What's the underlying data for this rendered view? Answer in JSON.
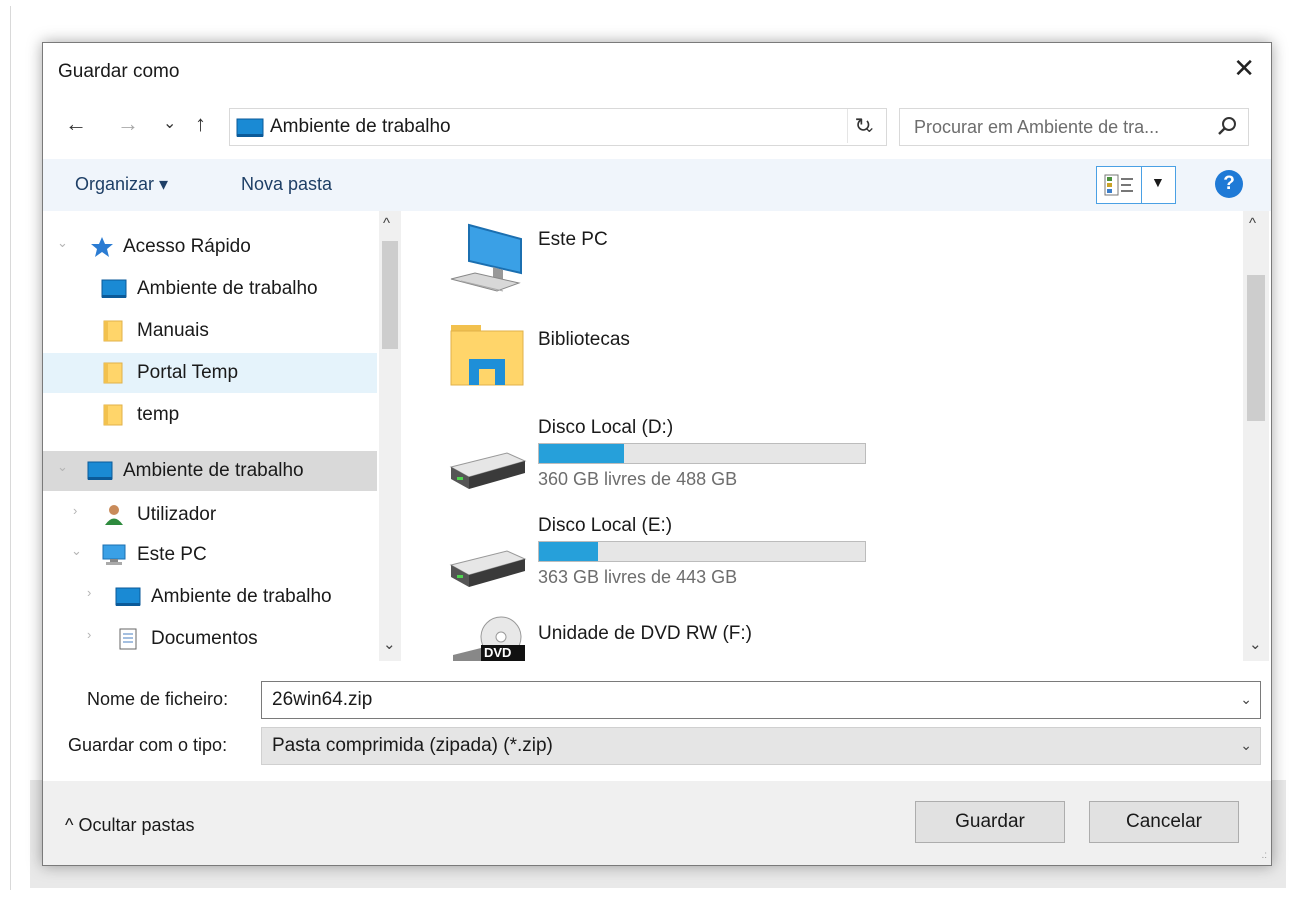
{
  "dialog": {
    "title": "Guardar como",
    "close_symbol": "✕"
  },
  "address_bar": {
    "back_symbol": "←",
    "forward_symbol": "→",
    "recent_symbol": "⌄",
    "up_symbol": "↑",
    "path": "Ambiente de trabalho",
    "dropdown_symbol": "⌄",
    "refresh_symbol": "↻",
    "search_placeholder": "Procurar em Ambiente de tra..."
  },
  "toolbar": {
    "organize_label": "Organizar ▾",
    "new_folder_label": "Nova pasta",
    "view_dropdown_symbol": "▼",
    "help_symbol": "?"
  },
  "nav_pane": {
    "items": [
      {
        "label": "Acesso Rápido",
        "icon": "star-icon"
      },
      {
        "label": "Ambiente de trabalho",
        "icon": "desktop-icon"
      },
      {
        "label": "Manuais",
        "icon": "folder-icon"
      },
      {
        "label": "Portal Temp",
        "icon": "folder-icon",
        "selected": true
      },
      {
        "label": "temp",
        "icon": "folder-icon"
      },
      {
        "label": "Ambiente de trabalho",
        "icon": "desktop-icon",
        "highlighted": true
      },
      {
        "label": "Utilizador",
        "icon": "user-icon"
      },
      {
        "label": "Este PC",
        "icon": "computer-icon"
      },
      {
        "label": "Ambiente de trabalho",
        "icon": "desktop-icon"
      },
      {
        "label": "Documentos",
        "icon": "document-icon"
      }
    ],
    "scroll_up": "^",
    "scroll_down": "⌄"
  },
  "content": {
    "items": [
      {
        "name": "Este PC",
        "icon": "computer-icon"
      },
      {
        "name": "Bibliotecas",
        "icon": "libraries-icon"
      },
      {
        "name": "Disco Local (D:)",
        "icon": "drive-icon",
        "free_text": "360 GB livres de 488 GB",
        "used_fraction": 0.26
      },
      {
        "name": "Disco Local (E:)",
        "icon": "drive-icon",
        "free_text": "363 GB livres de 443 GB",
        "used_fraction": 0.18
      },
      {
        "name": "Unidade de DVD RW (F:)",
        "icon": "dvd-icon",
        "dvd_label": "DVD"
      }
    ],
    "scroll_up": "^",
    "scroll_down": "⌄"
  },
  "fields": {
    "filename_label": "Nome de ficheiro:",
    "filename_value": "26win64.zip",
    "type_label": "Guardar com o tipo:",
    "type_value": "Pasta comprimida (zipada) (*.zip)",
    "dropdown_symbol": "⌄"
  },
  "footer": {
    "hide_folders_label": "^  Ocultar pastas",
    "save_label": "Guardar",
    "cancel_label": "Cancelar",
    "grip_symbol": ".:"
  },
  "colors": {
    "accent": "#26a0da",
    "toolbar_bg": "#f0f5fb",
    "selection_bg": "#e5f3fb"
  }
}
